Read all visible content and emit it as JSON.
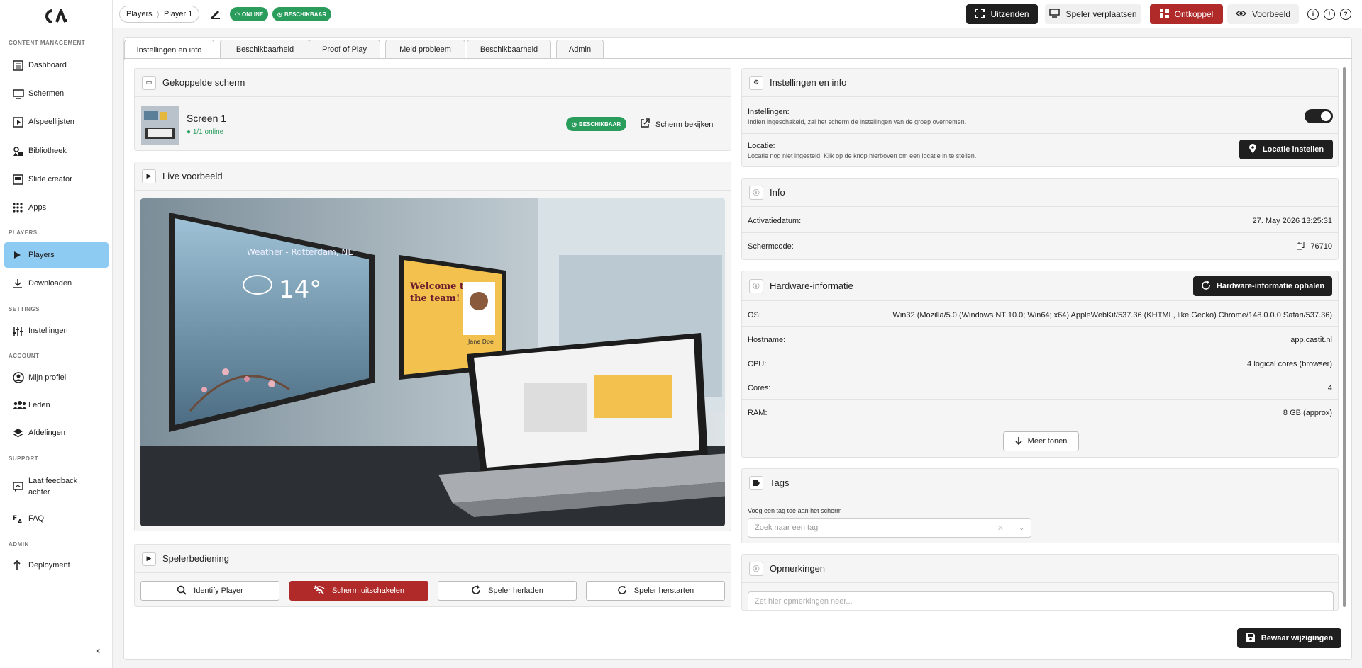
{
  "sidebar": {
    "sections": {
      "content": "CONTENT MANAGEMENT",
      "players": "PLAYERS",
      "settings": "SETTINGS",
      "account": "ACCOUNT",
      "support": "SUPPORT",
      "admin": "ADMIN"
    },
    "items": {
      "dashboard": "Dashboard",
      "screens": "Schermen",
      "playlists": "Afspeellijsten",
      "library": "Bibliotheek",
      "slide_creator": "Slide creator",
      "apps": "Apps",
      "players": "Players",
      "downloads": "Downloaden",
      "settings": "Instellingen",
      "profile": "Mijn profiel",
      "members": "Leden",
      "departments": "Afdelingen",
      "feedback_1": "Laat feedback",
      "feedback_2": "achter",
      "faq": "FAQ",
      "deployment": "Deployment"
    }
  },
  "topbar": {
    "crumb_1": "Players",
    "crumb_2": "Player 1",
    "status_online": "ONLINE",
    "status_available": "BESCHIKBAAR",
    "broadcast": "Uitzenden",
    "move_player": "Speler verplaatsen",
    "disconnect": "Ontkoppel",
    "preview": "Voorbeeld",
    "info_glyph": "i",
    "bell_glyph": "!",
    "help_glyph": "?"
  },
  "tabs": [
    "Instellingen en info",
    "Beschikbaarheid",
    "Proof of Play",
    "Meld probleem",
    "Beschikbaarheid",
    "Admin"
  ],
  "linked_screen": {
    "title": "Gekoppelde scherm",
    "name": "Screen 1",
    "online": "1/1 online",
    "badge": "BESCHIKBAAR",
    "view_button": "Scherm bekijken"
  },
  "live_preview": {
    "title": "Live voorbeeld",
    "weather_text": "Weather - Rotterdam, NL",
    "temperature": "14°",
    "welcome_line_1": "Welcome to",
    "welcome_line_2": "the team!",
    "welcome_name": "Jane Doe"
  },
  "player_control": {
    "title": "Spelerbediening",
    "identify": "Identify Player",
    "screen_off": "Scherm uitschakelen",
    "reload": "Speler herladen",
    "restart": "Speler herstarten"
  },
  "settings_info": {
    "title": "Instellingen en info",
    "settings_label": "Instellingen:",
    "settings_desc": "Indien ingeschakeld, zal het scherm de instellingen van de groep overnemen.",
    "settings_enabled": true,
    "location_label": "Locatie:",
    "location_desc": "Locatie nog niet ingesteld. Klik op de knop hierboven om een locatie in te stellen.",
    "location_button": "Locatie instellen"
  },
  "info": {
    "title": "Info",
    "activation_label": "Activatiedatum:",
    "activation_value": "27. May 2026 13:25:31",
    "code_label": "Schermcode:",
    "code_value": "76710"
  },
  "hardware": {
    "title": "Hardware-informatie",
    "fetch_button": "Hardware-informatie ophalen",
    "os_label": "OS:",
    "os_value": "Win32 (Mozilla/5.0 (Windows NT 10.0; Win64; x64) AppleWebKit/537.36 (KHTML, like Gecko) Chrome/148.0.0.0 Safari/537.36)",
    "hostname_label": "Hostname:",
    "hostname_value": "app.castit.nl",
    "cpu_label": "CPU:",
    "cpu_value": "4 logical cores (browser)",
    "cores_label": "Cores:",
    "cores_value": "4",
    "ram_label": "RAM:",
    "ram_value": "8 GB (approx)",
    "more_button": "Meer tonen"
  },
  "tags": {
    "title": "Tags",
    "label": "Voeg een tag toe aan het scherm",
    "placeholder": "Zoek naar een tag"
  },
  "notes": {
    "title": "Opmerkingen",
    "placeholder": "Zet hier opmerkingen neer..."
  },
  "footer": {
    "save": "Bewaar wijzigingen"
  },
  "colors": {
    "active_nav": "#8ecbf3",
    "success": "#2a9d5c",
    "danger": "#b02a2a",
    "dark": "#1f1f1f"
  }
}
